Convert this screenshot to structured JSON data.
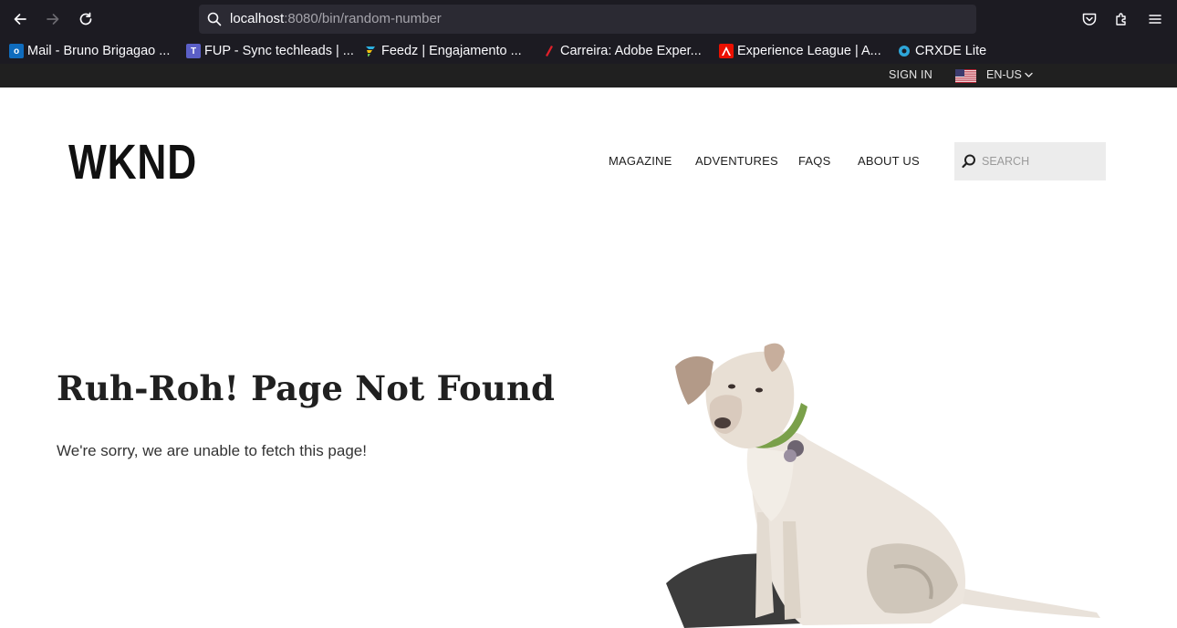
{
  "browser": {
    "url_host": "localhost",
    "url_rest": ":8080/bin/random-number",
    "bookmarks": [
      {
        "label": "Mail - Bruno Brigagao ...",
        "icon": "outlook-icon",
        "color": "#0f6cbd"
      },
      {
        "label": "FUP - Sync techleads | ...",
        "icon": "teams-icon",
        "color": "#5b5fc7"
      },
      {
        "label": "Feedz | Engajamento ...",
        "icon": "feedz-icon",
        "color": "#2bb0e0"
      },
      {
        "label": "Carreira: Adobe Exper...",
        "icon": "pencil-icon",
        "color": "#e0202a"
      },
      {
        "label": "Experience League | A...",
        "icon": "adobe-icon",
        "color": "#eb1000"
      },
      {
        "label": "CRXDE Lite",
        "icon": "crxde-icon",
        "color": "#2ea6d9"
      }
    ]
  },
  "site": {
    "sign_in": "SIGN IN",
    "language": "EN-US",
    "logo": "WKND",
    "nav": [
      "MAGAZINE",
      "ADVENTURES",
      "FAQS",
      "ABOUT US"
    ],
    "search_placeholder": "SEARCH"
  },
  "content": {
    "title": "Ruh-Roh! Page Not Found",
    "message": "We're sorry, we are unable to fetch this page!",
    "image_icon": "dog-illustration"
  }
}
